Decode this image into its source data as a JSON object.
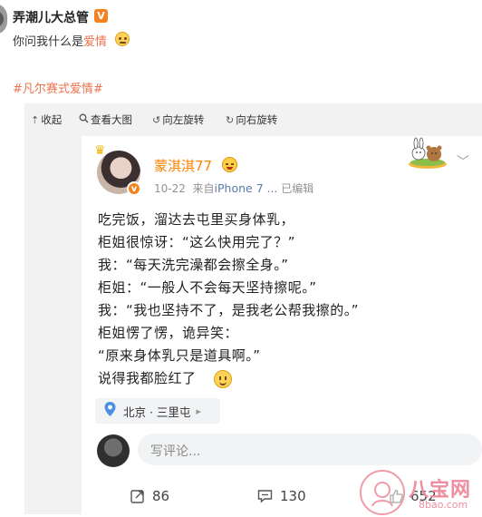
{
  "post": {
    "author": "弄潮儿大总管",
    "verified_badge": "V",
    "text_prefix": "你问我什么是",
    "text_highlight": "爱情",
    "topic": "#凡尔赛式爱情#"
  },
  "viewer_toolbar": {
    "collapse": {
      "icon": "collapse-up-icon",
      "label": "收起"
    },
    "view_large": {
      "icon": "magnifier-icon",
      "label": "查看大图"
    },
    "rotate_left": {
      "icon": "rotate-left-icon",
      "label": "向左旋转"
    },
    "rotate_right": {
      "icon": "rotate-right-icon",
      "label": "向右旋转"
    }
  },
  "inner_post": {
    "username": "蒙淇淇77",
    "avatar_badge": "v",
    "date": "10-22",
    "source_prefix": "来自",
    "device": "iPhone 7",
    "source_suffix": "...",
    "edited": "已编辑",
    "lines": [
      "吃完饭，溜达去屯里买身体乳，",
      "柜姐很惊讶：“这么快用完了？”",
      "我：“每天洗完澡都会擦全身。”",
      "柜姐：“一般人不会每天坚持擦呢。”",
      "我：“我也坚持不了，是我老公帮我擦的。”",
      "柜姐愣了愣，诡异笑：",
      "“原来身体乳只是道具啊。”",
      "说得我都脸红了"
    ],
    "location": "北京 · 三里屯",
    "comment_placeholder": "写评论...",
    "actions": {
      "forward_count": "86",
      "comment_count": "130",
      "like_count": "652"
    }
  },
  "watermark": {
    "text": "八宝网",
    "url": "8bao.com"
  },
  "colors": {
    "accent_orange": "#eb7350",
    "username_orange": "#ff8200",
    "device_blue": "#5d7ca9",
    "watermark_pink": "#ef8e9e"
  }
}
